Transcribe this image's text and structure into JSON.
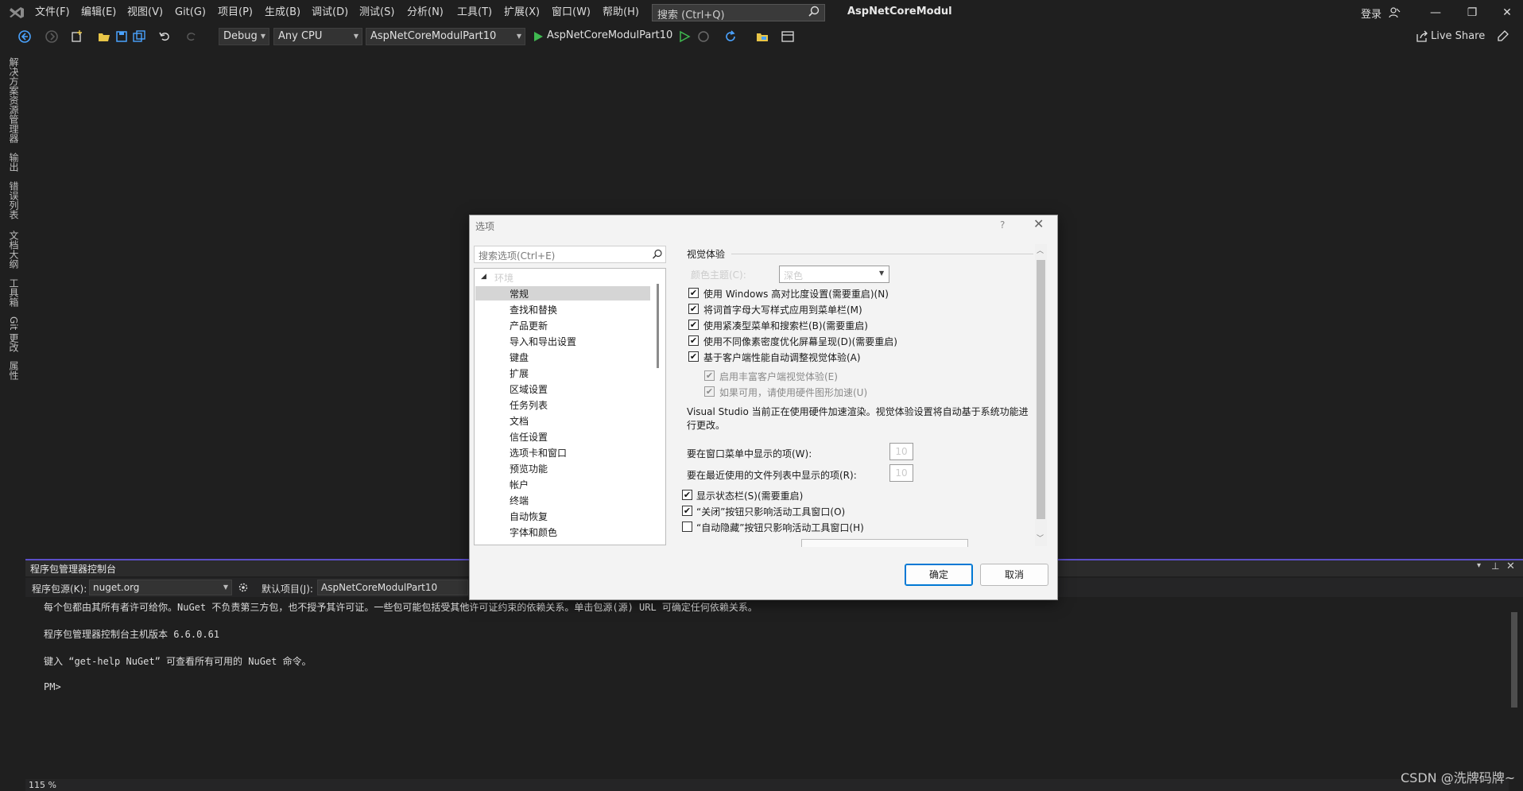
{
  "menu": {
    "items": [
      "文件(F)",
      "编辑(E)",
      "视图(V)",
      "Git(G)",
      "项目(P)",
      "生成(B)",
      "调试(D)",
      "测试(S)",
      "分析(N)",
      "工具(T)",
      "扩展(X)",
      "窗口(W)",
      "帮助(H)"
    ],
    "search_placeholder": "搜索 (Ctrl+Q)",
    "app_title": "AspNetCoreModul",
    "login": "登录",
    "window_controls": [
      "—",
      "❐",
      "✕"
    ]
  },
  "toolbar": {
    "config": "Debug",
    "platform": "Any CPU",
    "startup_project": "AspNetCoreModulPart10",
    "run_target": "AspNetCoreModulPart10",
    "live_share": "Live Share"
  },
  "side_tabs": [
    "解决方案资源管理器",
    "输出",
    "错误列表",
    "文档大纲",
    "工具箱",
    "Git 更改",
    "属性"
  ],
  "dialog": {
    "title": "选项",
    "help": "?",
    "close": "✕",
    "search_placeholder": "搜索选项(Ctrl+E)",
    "tree_root": "环境",
    "tree_items": [
      "常规",
      "查找和替换",
      "产品更新",
      "导入和导出设置",
      "键盘",
      "扩展",
      "区域设置",
      "任务列表",
      "文档",
      "信任设置",
      "选项卡和窗口",
      "预览功能",
      "帐户",
      "终端",
      "自动恢复",
      "字体和颜色"
    ],
    "section_title": "视觉体验",
    "theme_label": "颜色主题(C):",
    "theme_value": "深色",
    "checkboxes": [
      {
        "label": "使用 Windows 高对比度设置(需要重启)(N)",
        "checked": "✔"
      },
      {
        "label": "将词首字母大写样式应用到菜单栏(M)",
        "checked": "✔"
      },
      {
        "label": "使用紧凑型菜单和搜索栏(B)(需要重启)",
        "checked": "✔"
      },
      {
        "label": "使用不同像素密度优化屏幕呈现(D)(需要重启)",
        "checked": "✔"
      },
      {
        "label": "基于客户端性能自动调整视觉体验(A)",
        "checked": "✔"
      }
    ],
    "sub_checkboxes": [
      {
        "label": "启用丰富客户端视觉体验(E)",
        "checked": "✔"
      },
      {
        "label": "如果可用，请使用硬件图形加速(U)",
        "checked": "✔"
      }
    ],
    "info": "Visual Studio 当前正在使用硬件加速渲染。视觉体验设置将自动基于系统功能进行更改。",
    "window_menu_label": "要在窗口菜单中显示的项(W):",
    "window_menu_value": "10",
    "recent_files_label": "要在最近使用的文件列表中显示的项(R):",
    "recent_files_value": "10",
    "bottom_checkboxes": [
      {
        "label": "显示状态栏(S)(需要重启)",
        "checked": "✔"
      },
      {
        "label": "“关闭”按钮只影响活动工具窗口(O)",
        "checked": "✔"
      },
      {
        "label": "“自动隐藏”按钮只影响活动工具窗口(H)",
        "checked": ""
      }
    ],
    "ok": "确定",
    "cancel": "取消"
  },
  "console": {
    "title": "程序包管理器控制台",
    "source_label": "程序包源(K):",
    "source_value": "nuget.org",
    "project_label": "默认项目(J):",
    "project_value": "AspNetCoreModulPart10",
    "lines": [
      "每个包都由其所有者许可给你。NuGet 不负责第三方包，也不授予其许可证。一些包可能包括受其他许可证约束的依赖关系。单击包源(源) URL 可确定任何依赖关系。",
      "程序包管理器控制台主机版本 6.6.0.61",
      "键入 “get-help NuGet” 可查看所有可用的 NuGet 命令。",
      "PM>"
    ],
    "zoom": "115 %"
  },
  "watermark": "CSDN @洗牌码牌~",
  "colors": {
    "accent": "#5b4ec7",
    "run_green": "#3fb950",
    "vs_blue": "#0078d4"
  }
}
